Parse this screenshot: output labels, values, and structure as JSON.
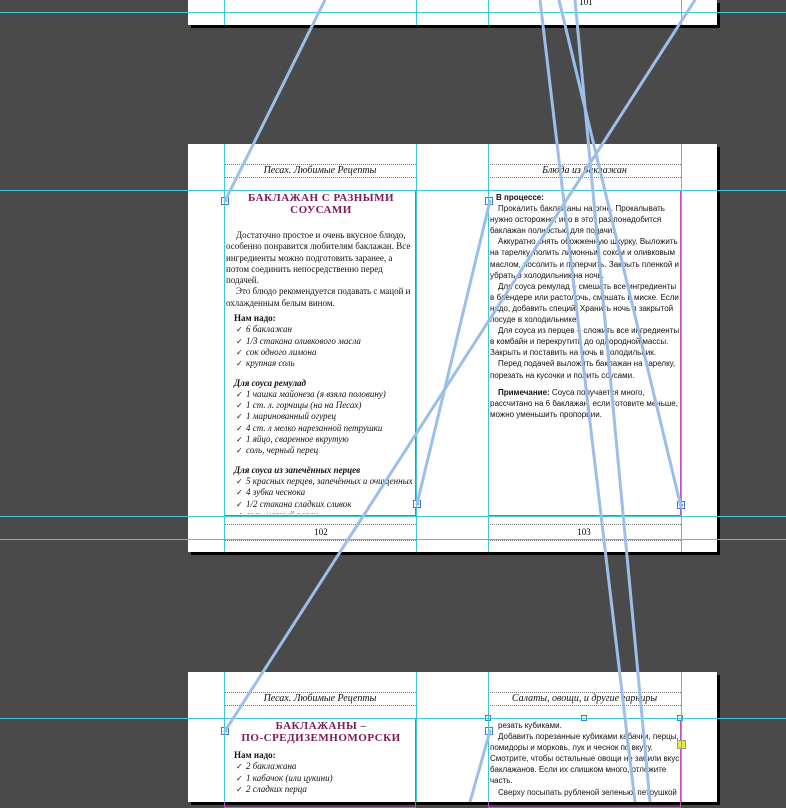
{
  "page_top": {
    "left_num": "101"
  },
  "spread1": {
    "left": {
      "running_head": "Песах. Любимые Рецепты",
      "title_line1": "БАКЛАЖАН С РАЗНЫМИ",
      "title_line2": "СОУСАМИ",
      "intro": "Достаточно простое и очень вкусное блюдо, особенно понравится любителям баклажан. Все ингредиенты можно подготовить заранее, а потом соединить непосредственно перед подачей.",
      "intro2": "Это блюдо рекомендуется подавать с мацой и охлажденным белым вином.",
      "need_heading": "Нам надо:",
      "need_items": [
        "6 баклажан",
        "1/3 стакана оливкового масла",
        "сок одного лимона",
        "крупная соль"
      ],
      "remoulade_heading": "Для соуса ремулад",
      "remoulade_items": [
        "1 чашка майонеза (я взяла половину)",
        "1 ст. л. горчицы (на на Песах)",
        "1 маринованный огурец",
        "4 ст. л мелко нарезанной петрушки",
        "1 яйцо, сваренное вкрутую",
        "соль, черный перец"
      ],
      "pepper_heading": "Для соуса из запечённых перцев",
      "pepper_items": [
        "5 красных перцев, запечённых и очищенных",
        "4 зубка чеснока",
        "1/2 стакана сладких сливок",
        "соль, черный перец"
      ],
      "page_number": "102"
    },
    "right": {
      "running_head": "Блюда из баклажан",
      "process_heading": "В процессе:",
      "paragraphs": [
        "Прокалить баклажаны на огне. Прокалывать нужно осторожно, ибо в этот раз понадобится баклажан полностью для подачи.",
        "Аккуратно снять обожженную шкурку. Выложить на тарелку, полить лимонным соком и оливковым маслом, посолить и поперчить. Закрыть пленкой и убрать в холодильник на ночь.",
        "Для соуса ремулад – смешать все ингредиенты в блендере или растолочь, смешать в миске. Если надо, добавить специй. Хранить ночь в закрытой посуде в холодильнике.",
        "Для соуса из перцев – сложить все ингредиенты в комбайн и перекрутить до однородной массы. Закрыть и поставить на ночь в холодильник.",
        "Перед подачей выложить баклажан на тарелку, порезать на кусочки и полить соусами."
      ],
      "note_label": "Примечание:",
      "note_text": "Соуса получается много, рассчитано на 6 баклажан, если готовите меньше, можно уменьшить пропорции.",
      "page_number": "103"
    }
  },
  "spread2": {
    "left": {
      "running_head": "Песах. Любимые Рецепты",
      "title_line1": "БАКЛАЖАНЫ –",
      "title_line2": "ПО-СРЕДИЗЕМНОМОРСКИ",
      "need_heading": "Нам надо:",
      "need_items": [
        "2 баклажана",
        "1 кабачок (или цукини)",
        "2 сладких перца"
      ]
    },
    "right": {
      "running_head": "Салаты, овощи, и другие гарниры",
      "lines": [
        "резать кубиками.",
        "Добавить порезанные кубиками кабачки, перцы, помидоры и морковь, лук и чеснок по вкусу. Смотрите, чтобы остальные овощи не забили вкус баклажанов. Если их слишком много, отложите часть.",
        "Сверху посыпать рубленой зеленью: петрушкой"
      ]
    }
  },
  "colors": {
    "pasteboard": "#4a4a4a",
    "guide": "#3fc7d8",
    "margin": "#c44fc4",
    "thread": "#9cbfea",
    "title": "#7d1a5a"
  }
}
